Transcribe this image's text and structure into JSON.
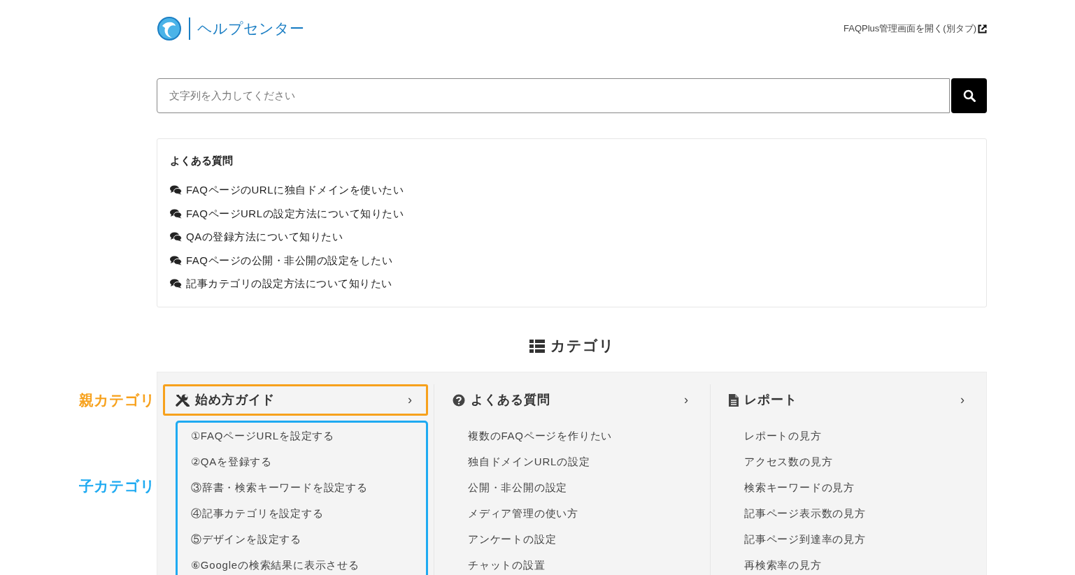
{
  "header": {
    "title": "ヘルプセンター",
    "admin_link": "FAQPlus管理画面を開く(別タブ)"
  },
  "search": {
    "placeholder": "文字列を入力してください"
  },
  "faq": {
    "heading": "よくある質問",
    "items": [
      "FAQページのURLに独自ドメインを使いたい",
      "FAQページURLの設定方法について知りたい",
      "QAの登録方法について知りたい",
      "FAQページの公開・非公開の設定をしたい",
      "記事カテゴリの設定方法について知りたい"
    ]
  },
  "categories_heading": "カテゴリ",
  "categories": [
    {
      "kind": "tools",
      "title": "始め方ガイド",
      "chevron": "›",
      "header_callout": {
        "label": "親カテゴリ",
        "color": "#f7a11c"
      },
      "items_callout": {
        "label": "子カテゴリ",
        "color": "#1eaaf1"
      },
      "items": [
        "①FAQページURLを設定する",
        "②QAを登録する",
        "③辞書・検索キーワードを設定する",
        "④記事カテゴリを設定する",
        "⑤デザインを設定する",
        "⑥Googleの検索結果に表示させる"
      ]
    },
    {
      "kind": "question",
      "title": "よくある質問",
      "chevron": "›",
      "items": [
        "複数のFAQページを作りたい",
        "独自ドメインURLの設定",
        "公開・非公開の設定",
        "メディア管理の使い方",
        "アンケートの設定",
        "チャットの設置"
      ]
    },
    {
      "kind": "file",
      "title": "レポート",
      "chevron": "›",
      "items": [
        "レポートの見方",
        "アクセス数の見方",
        "検索キーワードの見方",
        "記事ページ表示数の見方",
        "記事ページ到達率の見方",
        "再検索率の見方"
      ]
    }
  ]
}
